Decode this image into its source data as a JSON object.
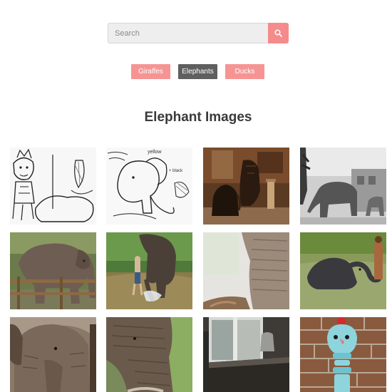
{
  "search": {
    "placeholder": "Search",
    "icon": "search-icon"
  },
  "filters": [
    {
      "label": "Giraffes",
      "active": false
    },
    {
      "label": "Elephants",
      "active": true
    },
    {
      "label": "Ducks",
      "active": false
    }
  ],
  "heading": "Elephant Images",
  "colors": {
    "accent": "#f58b8b",
    "active_filter": "#5f5f5f",
    "search_bg": "#eeeeee",
    "heading": "#3a3a3a"
  },
  "gallery": [
    {
      "subject": "sketch of a cartoon boy with a crown riding an elephant"
    },
    {
      "subject": "sketch of an elephant with handwritten color notes"
    },
    {
      "subject": "carved wooden elephant figurines on a shelf"
    },
    {
      "subject": "black and white photo of elephants beside a building"
    },
    {
      "subject": "elephant standing behind a wooden fence"
    },
    {
      "subject": "person bathing an elephant in a river"
    },
    {
      "subject": "close-up of an elephant trunk"
    },
    {
      "subject": "man washing an elephant in a pool"
    },
    {
      "subject": "close-up of an elephant head"
    },
    {
      "subject": "elephant trunk close-up outdoors"
    },
    {
      "subject": "window sill with a vase indoors"
    },
    {
      "subject": "blue toy figure against a brick wall"
    }
  ]
}
